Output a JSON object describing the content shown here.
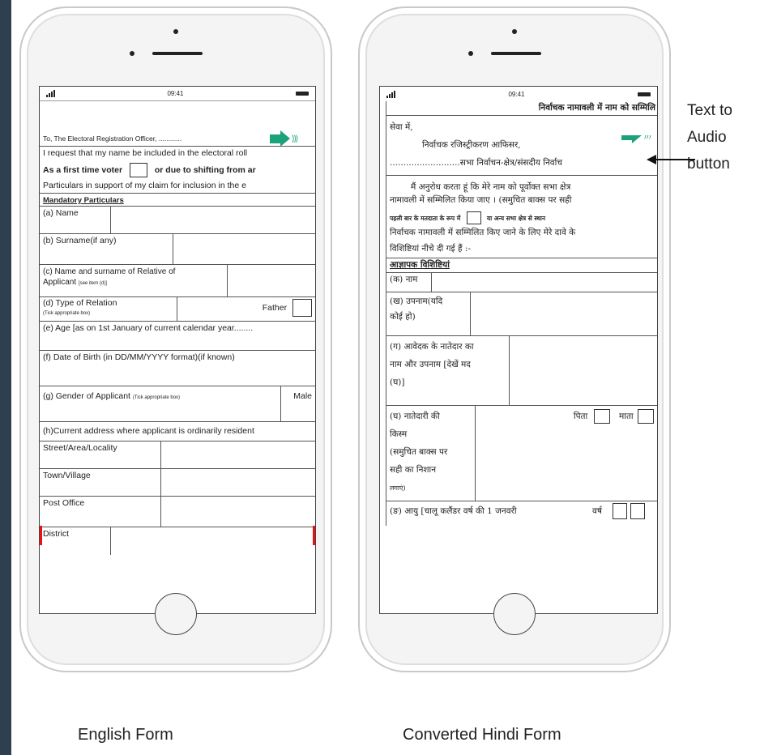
{
  "english_phone": {
    "time": "09:41",
    "rows": {
      "to": "To, The Electoral Registration Officer, ............",
      "request": "I request that my name be included in the electoral roll",
      "first_time": "As a first time voter",
      "shifting": "or due to shifting from ar",
      "particulars_support": "Particulars in support of my claim for inclusion in the e",
      "mandatory": "Mandatory Particulars",
      "name": "(a) Name",
      "surname": "(b) Surname(if any)",
      "relative_1": "(c) Name and surname of Relative of",
      "relative_2": "Applicant",
      "relative_note": "[see item (d)]",
      "relation": "(d) Type of Relation",
      "relation_note": "(Tick appropriate box)",
      "father": "Father",
      "age": "(e) Age [as on 1st January of current calendar year........",
      "dob": "(f) Date of Birth (in DD/MM/YYYY format)(if known)",
      "gender": "(g) Gender of Applicant",
      "gender_note": "(Tick appropriate box)",
      "male": "Male",
      "address": "(h)Current address where applicant is ordinarily resident",
      "street": "Street/Area/Locality",
      "town": "Town/Village",
      "post_office": "Post Office",
      "district": "District"
    }
  },
  "hindi_phone": {
    "time": "09:41",
    "rows": {
      "heading": "निर्वाचक नामावली में नाम को सम्मिलि",
      "to": "सेवा में,",
      "officer": "निर्वाचक रजिस्ट्रीकरण आफिसर,",
      "constituency": "..........................सभा निर्वाचन-क्षेत्र/संसदीय निर्वाच",
      "para_1": "मैं अनुरोध करता हूं कि मेरे नाम को पूर्वोक्त सभा क्षेत्र",
      "para_2": "नामावली में सम्मिलित किया जाए । (समुचित बाक्स पर सही",
      "para_3a": "पहली बार के मतदाता के रूप में",
      "para_3b": "या अन्य सभा क्षेत्र से स्थान",
      "para_4": "निर्वाचक नामावली में सम्मिलित किए जाने के लिए मेरे दावे के",
      "para_5": "विशिष्टियां नीचे दी गई हैं :-",
      "mandatory": "आज्ञापक विशिष्टियां",
      "name": "(क) नाम",
      "surname_1": "(ख) उपनाम(यदि",
      "surname_2": "कोई हो)",
      "relative_1": "(ग) आवेदक के नातेदार का",
      "relative_2": "नाम और उपनाम [देखें मद",
      "relative_3": "(घ)]",
      "relation_1": "(घ) नातेदारी की",
      "relation_2": "किस्म",
      "relation_3": "(समुचित बाक्स पर",
      "relation_4": "सही का निशान",
      "relation_5": "लगाएं)",
      "father": "पिता",
      "mother": "माता",
      "age": "(ङ) आयु [चालू कलैंडर वर्ष की 1 जनवरी",
      "years": "वर्ष"
    }
  },
  "annotation": {
    "line1": "Text to",
    "line2": "Audio",
    "line3": "button"
  },
  "captions": {
    "english": "English Form",
    "hindi": "Converted Hindi Form"
  },
  "colors": {
    "audio_icon": "#1aa37a",
    "left_bar": "#2e3f50"
  },
  "icons": {
    "audio": "speaker-audio-icon",
    "arrow": "left-arrow"
  }
}
